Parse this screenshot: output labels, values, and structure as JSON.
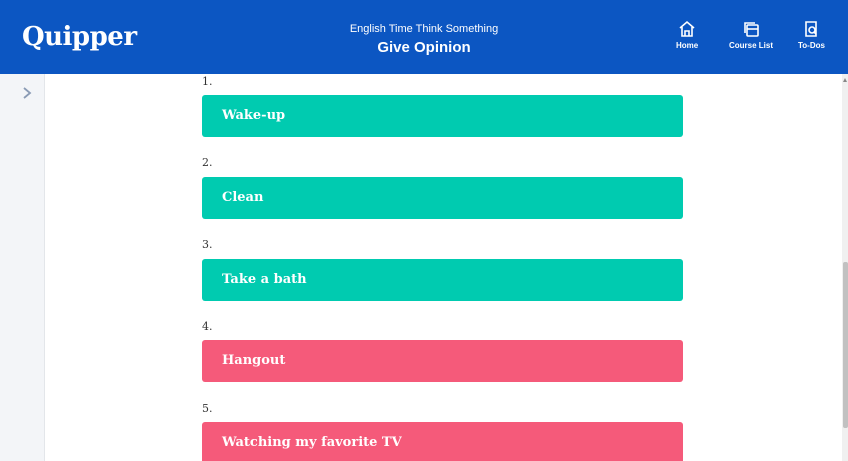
{
  "header": {
    "logo": "Quipper",
    "subtitle": "English Time Think Something",
    "title": "Give Opinion",
    "nav": {
      "home": {
        "label": "Home",
        "icon": "home-icon"
      },
      "courses": {
        "label": "Course List",
        "icon": "course-list-icon"
      },
      "todos": {
        "label": "To-Dos",
        "icon": "todos-icon"
      }
    }
  },
  "colors": {
    "header_bg": "#0c56c2",
    "teal": "#00cbb0",
    "pink": "#f55a7a"
  },
  "items": [
    {
      "number": "1.",
      "text": "Wake-up",
      "color": "#00cbb0"
    },
    {
      "number": "2.",
      "text": "Clean",
      "color": "#00cbb0"
    },
    {
      "number": "3.",
      "text": "Take a bath",
      "color": "#00cbb0"
    },
    {
      "number": "4.",
      "text": "Hangout",
      "color": "#f55a7a"
    },
    {
      "number": "5.",
      "text": "Watching my favorite TV",
      "color": "#f55a7a"
    }
  ]
}
